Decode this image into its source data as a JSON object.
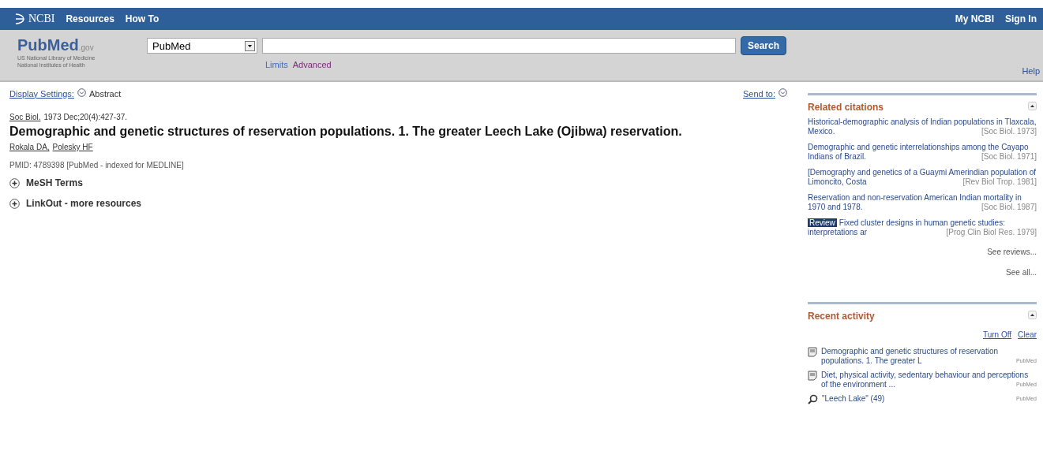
{
  "topbar": {
    "brand": "NCBI",
    "menus": [
      {
        "label": "Resources"
      },
      {
        "label": "How To"
      }
    ],
    "links": [
      "My NCBI",
      "Sign In"
    ]
  },
  "header": {
    "logo": "PubMed",
    "logo_suffix": ".gov",
    "org_lines": [
      "US National Library of Medicine",
      "National Institutes of Health"
    ],
    "database": "PubMed",
    "search_button": "Search",
    "links": [
      "Limits",
      "Advanced"
    ],
    "help": "Help"
  },
  "display": {
    "settings": "Display Settings:",
    "format": "Abstract",
    "send_to": "Send to:"
  },
  "article": {
    "journal": "Soc Biol.",
    "citation": "1973 Dec;20(4):427-37.",
    "title": "Demographic and genetic structures of reservation populations. 1. The greater Leech Lake (Ojibwa) reservation.",
    "authors": [
      "Rokala DA,",
      "Polesky HF"
    ],
    "pmid": "PMID: 4789398 [PubMed - indexed for MEDLINE]",
    "sections": [
      {
        "label": "MeSH Terms",
        "expanded": false
      },
      {
        "label": "LinkOut - more resources",
        "expanded": false
      }
    ]
  },
  "related": {
    "title": "Related citations",
    "items": [
      {
        "text": "Historical-demographic analysis of Indian populations in Tlaxcala, Mexico.",
        "source": "[Soc Biol. 1973]"
      },
      {
        "text": "Demographic and genetic interrelationships among the Cayapo Indians of Brazil.",
        "source": "[Soc Biol. 1971]"
      },
      {
        "text": "[Demography and genetics of a Guaymi Amerindian population of Limoncito, Costa",
        "source": "[Rev Biol Trop. 1981]"
      },
      {
        "text": "Reservation and non-reservation American Indian mortality in 1970 and 1978.",
        "source": "[Soc Biol. 1987]"
      },
      {
        "text": "Fixed cluster designs in human genetic studies: interpretations ar",
        "source": "[Prog Clin Biol Res. 1979]",
        "badge": "Review"
      }
    ],
    "more": [
      "See reviews...",
      "See all..."
    ]
  },
  "recent": {
    "title": "Recent activity",
    "actions": [
      "Turn Off",
      "Clear"
    ],
    "items": [
      {
        "kind": "doc",
        "text": "Demographic and genetic structures of reservation populations. 1. The greater L",
        "db": "PubMed"
      },
      {
        "kind": "doc",
        "text": "Diet, physical activity, sedentary behaviour and perceptions of the environment ...",
        "db": "PubMed"
      },
      {
        "kind": "search",
        "text": "\"Leech Lake\" (49)",
        "db": "PubMed"
      }
    ]
  }
}
